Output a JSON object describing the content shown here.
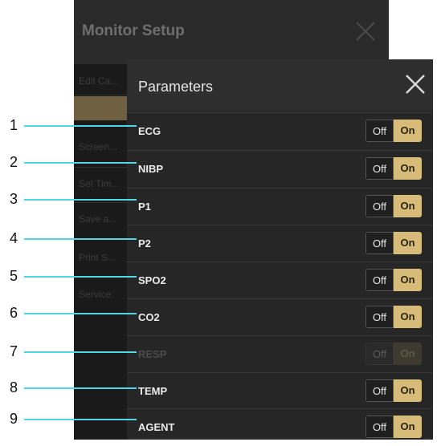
{
  "background_window": {
    "title": "Monitor Setup",
    "menu_items": [
      "Edit Ca...",
      "",
      "Screen...",
      "Set Tim...",
      "Save a...",
      "Print S...",
      "Service"
    ]
  },
  "panel": {
    "title": "Parameters",
    "rows": [
      {
        "label": "ECG",
        "off_label": "Off",
        "on_label": "On",
        "state": "on",
        "enabled": true
      },
      {
        "label": "NIBP",
        "off_label": "Off",
        "on_label": "On",
        "state": "on",
        "enabled": true
      },
      {
        "label": "P1",
        "off_label": "Off",
        "on_label": "On",
        "state": "on",
        "enabled": true
      },
      {
        "label": "P2",
        "off_label": "Off",
        "on_label": "On",
        "state": "on",
        "enabled": true
      },
      {
        "label": "SPO2",
        "off_label": "Off",
        "on_label": "On",
        "state": "on",
        "enabled": true
      },
      {
        "label": "CO2",
        "off_label": "Off",
        "on_label": "On",
        "state": "on",
        "enabled": true
      },
      {
        "label": "RESP",
        "off_label": "Off",
        "on_label": "On",
        "state": "on",
        "enabled": false
      },
      {
        "label": "TEMP",
        "off_label": "Off",
        "on_label": "On",
        "state": "on",
        "enabled": true
      },
      {
        "label": "AGENT",
        "off_label": "Off",
        "on_label": "On",
        "state": "on",
        "enabled": true
      }
    ]
  },
  "callouts": [
    "1",
    "2",
    "3",
    "4",
    "5",
    "6",
    "7",
    "8",
    "9"
  ],
  "colors": {
    "accent_on": "#d7bb78",
    "callout_line": "#4fd6e8",
    "panel_bg": "#262626"
  },
  "icons": {
    "panel_close": "close-icon",
    "background_close": "close-icon"
  }
}
